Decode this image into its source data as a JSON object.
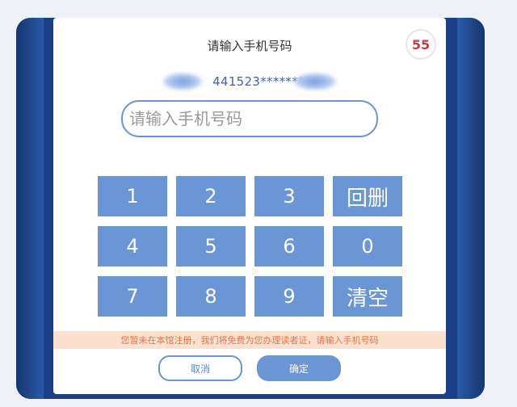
{
  "dialog": {
    "title": "请输入手机号码",
    "countdown": "55",
    "id_masked": "441523*******",
    "phone_input": {
      "placeholder": "请输入手机号码",
      "value": ""
    },
    "keypad": {
      "keys": [
        "1",
        "2",
        "3",
        "回删",
        "4",
        "5",
        "6",
        "0",
        "7",
        "8",
        "9",
        "清空"
      ]
    },
    "notice": "您暂未在本馆注册，我们将免费为您办理读者证，请输入手机号码",
    "buttons": {
      "cancel": "取消",
      "confirm": "确定"
    }
  },
  "colors": {
    "frame": "#1b3f86",
    "key_bg": "#6b96d5",
    "countdown": "#d0383b",
    "notice_bg": "#fbe1cd",
    "notice_text": "#e0744a"
  }
}
